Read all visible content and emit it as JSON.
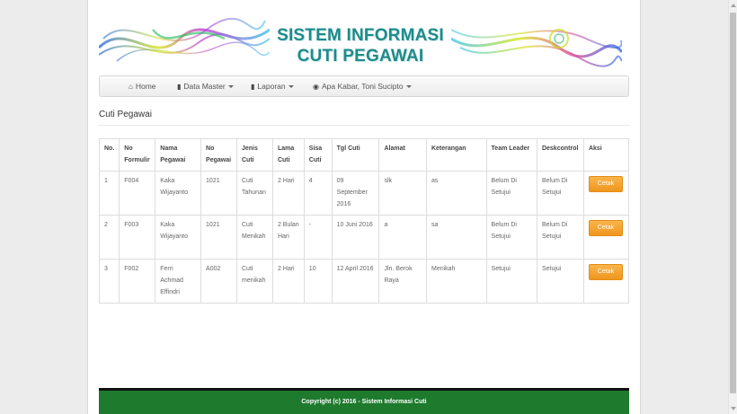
{
  "banner": {
    "title_line1": "SISTEM INFORMASI",
    "title_line2": "CUTI PEGAWAI"
  },
  "navbar": {
    "items": [
      {
        "label": "Home",
        "icon": "home-icon",
        "dropdown": false
      },
      {
        "label": "Data Master",
        "icon": "file-icon",
        "dropdown": true
      },
      {
        "label": "Laporan",
        "icon": "file-icon",
        "dropdown": true
      },
      {
        "label": "Apa Kabar, Toni Sucipto",
        "icon": "globe-icon",
        "dropdown": true
      }
    ]
  },
  "section_title": "Cuti Pegawai",
  "table": {
    "headers": [
      "No.",
      "No Formulir",
      "Nama Pegawai",
      "No Pegawai",
      "Jenis Cuti",
      "Lama Cuti",
      "Sisa Cuti",
      "Tgl Cuti",
      "Alamat",
      "Keterangan",
      "Team Leader",
      "Deskcontrol",
      "Aksi"
    ],
    "rows": [
      {
        "no": "1",
        "formulir": "F004",
        "nama": "Kaka Wijayanto",
        "pegawai": "1021",
        "jenis": "Cuti Tahunan",
        "lama": "2 Hari",
        "sisa": "4",
        "tgl": "09 September 2016",
        "alamat": "slk",
        "keterangan": "as",
        "team_leader": "Belum Di Setujui",
        "deskcontrol": "Belum Di Setujui",
        "aksi": "Cetak"
      },
      {
        "no": "2",
        "formulir": "F003",
        "nama": "Kaka Wijayanto",
        "pegawai": "1021",
        "jenis": "Cuti Menikah",
        "lama": "2 Bulan Hari",
        "sisa": "-",
        "tgl": "10 Juni 2016",
        "alamat": "a",
        "keterangan": "sa",
        "team_leader": "Belum Di Setujui",
        "deskcontrol": "Belum Di Setujui",
        "aksi": "Cetak"
      },
      {
        "no": "3",
        "formulir": "F002",
        "nama": "Ferri Achmad Effindri",
        "pegawai": "A002",
        "jenis": "Cuti menikah",
        "lama": "2 Hari",
        "sisa": "10",
        "tgl": "12 April 2016",
        "alamat": "Jln. Berok Raya",
        "keterangan": "Menikah",
        "team_leader": "Setujui",
        "deskcontrol": "Setujui",
        "aksi": "Cetak"
      }
    ]
  },
  "footer": {
    "text": "Copyright (c) 2016 - Sistem Informasi Cuti"
  },
  "colors": {
    "title": "#1e8b8b",
    "footer_bg": "#1e7a2d",
    "button": "#f0961e"
  }
}
